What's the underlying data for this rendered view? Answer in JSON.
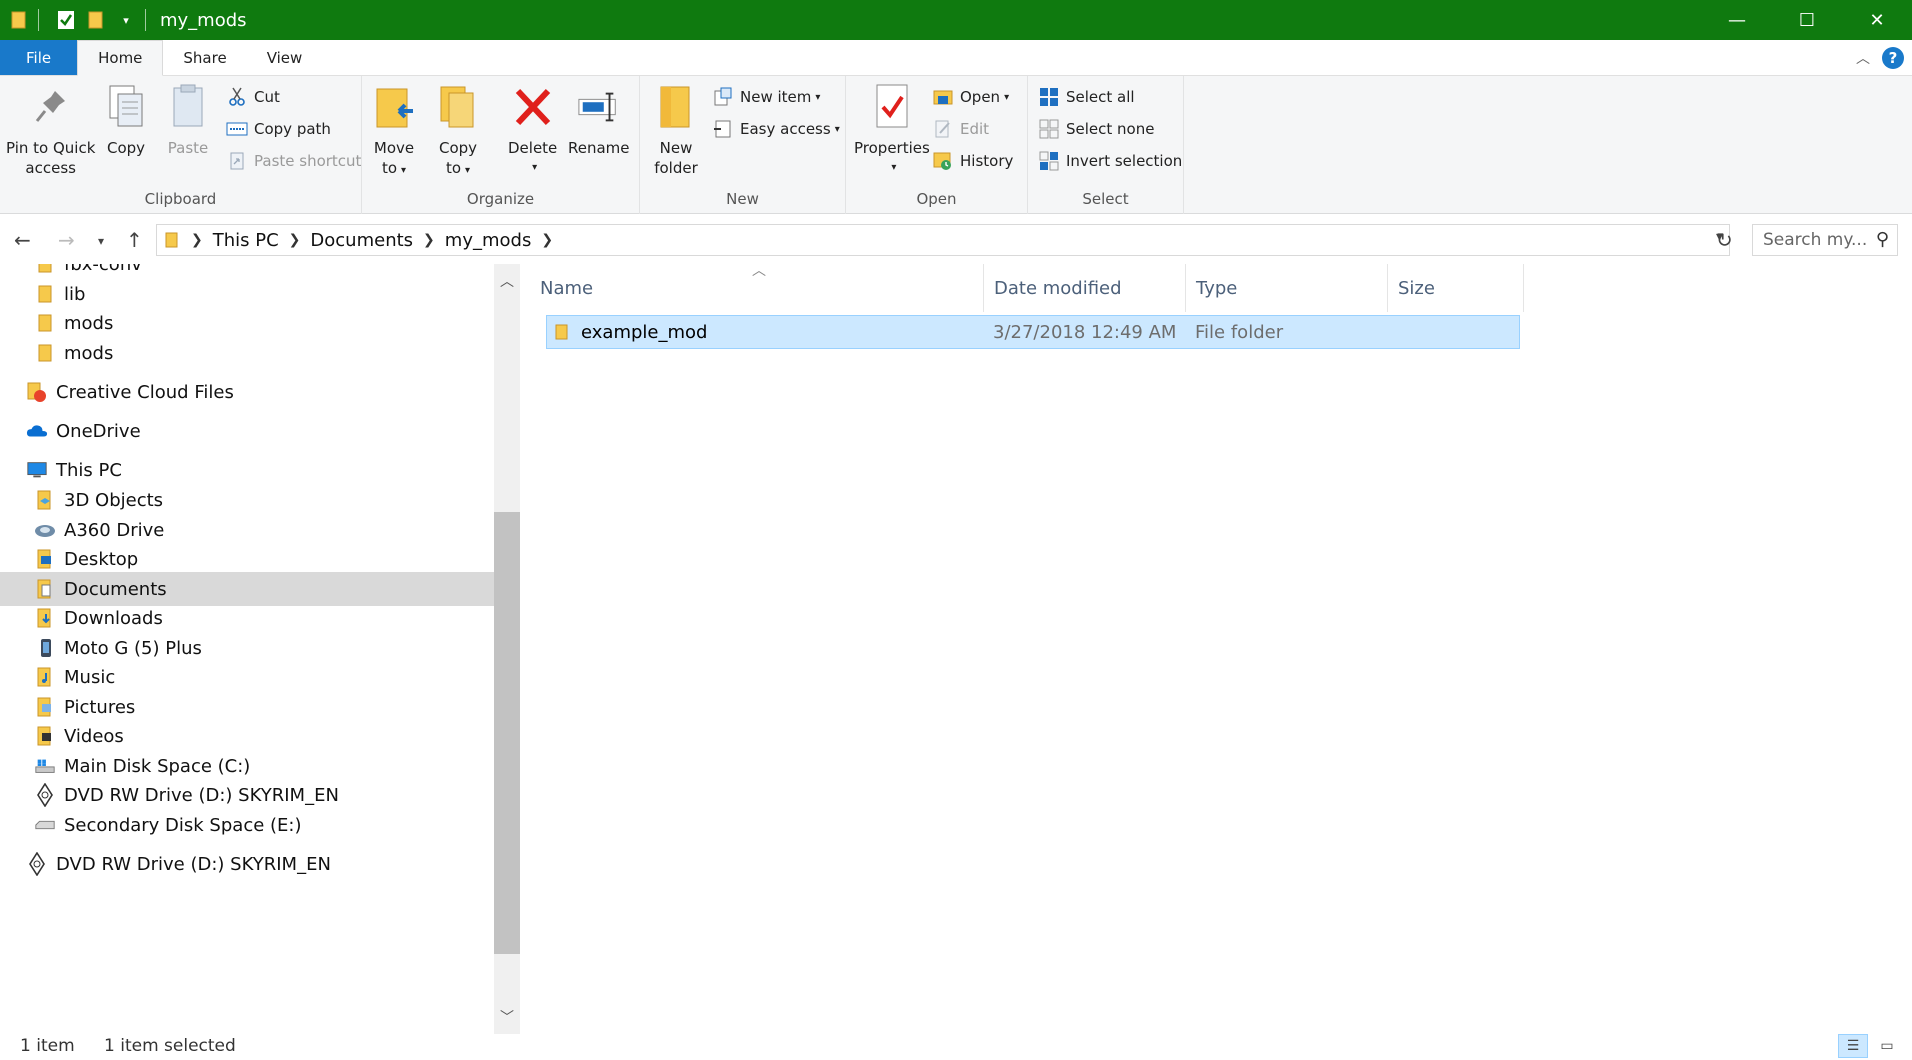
{
  "window": {
    "title": "my_mods",
    "minimize": "—",
    "maximize": "☐",
    "close": "✕"
  },
  "colors": {
    "titlebar": "#0f7a0f",
    "file_tab": "#1979ca",
    "selection": "#cce8ff",
    "selected_nav": "#d9d9d9",
    "folder": "#f6c94b"
  },
  "tabs": {
    "file": "File",
    "home": "Home",
    "share": "Share",
    "view": "View",
    "help": "?"
  },
  "ribbon": {
    "clipboard": {
      "label": "Clipboard",
      "pin_line1": "Pin to Quick",
      "pin_line2": "access",
      "copy": "Copy",
      "paste": "Paste",
      "cut": "Cut",
      "copy_path": "Copy path",
      "paste_shortcut": "Paste shortcut"
    },
    "organize": {
      "label": "Organize",
      "move_line1": "Move",
      "move_line2": "to",
      "copy_line1": "Copy",
      "copy_line2": "to",
      "delete": "Delete",
      "rename": "Rename"
    },
    "new": {
      "label": "New",
      "folder_line1": "New",
      "folder_line2": "folder",
      "new_item": "New item",
      "easy_access": "Easy access"
    },
    "open": {
      "label": "Open",
      "properties": "Properties",
      "open": "Open",
      "edit": "Edit",
      "history": "History"
    },
    "select": {
      "label": "Select",
      "select_all": "Select all",
      "select_none": "Select none",
      "invert": "Invert selection"
    }
  },
  "address": {
    "crumbs": [
      "This PC",
      "Documents",
      "my_mods"
    ],
    "search_placeholder": "Search my..."
  },
  "nav_tree": [
    {
      "label": "fbx-conv",
      "icon": "folder-icon",
      "level": 2
    },
    {
      "label": "lib",
      "icon": "folder-icon",
      "level": 2
    },
    {
      "label": "mods",
      "icon": "folder-icon",
      "level": 2
    },
    {
      "label": "mods",
      "icon": "folder-icon",
      "level": 2
    },
    {
      "label": "Creative Cloud Files",
      "icon": "creative-cloud-icon",
      "level": 1
    },
    {
      "label": "OneDrive",
      "icon": "onedrive-icon",
      "level": 1
    },
    {
      "label": "This PC",
      "icon": "computer-icon",
      "level": 1
    },
    {
      "label": "3D Objects",
      "icon": "folder-3d-icon",
      "level": 2
    },
    {
      "label": "A360 Drive",
      "icon": "a360-drive-icon",
      "level": 2
    },
    {
      "label": "Desktop",
      "icon": "desktop-folder-icon",
      "level": 2
    },
    {
      "label": "Documents",
      "icon": "documents-folder-icon",
      "level": 2,
      "selected": true
    },
    {
      "label": "Downloads",
      "icon": "downloads-folder-icon",
      "level": 2
    },
    {
      "label": "Moto G (5) Plus",
      "icon": "phone-icon",
      "level": 2
    },
    {
      "label": "Music",
      "icon": "music-folder-icon",
      "level": 2
    },
    {
      "label": "Pictures",
      "icon": "pictures-folder-icon",
      "level": 2
    },
    {
      "label": "Videos",
      "icon": "videos-folder-icon",
      "level": 2
    },
    {
      "label": "Main Disk Space (C:)",
      "icon": "windows-drive-icon",
      "level": 2
    },
    {
      "label": "DVD RW Drive (D:) SKYRIM_EN",
      "icon": "dvd-drive-icon",
      "level": 2
    },
    {
      "label": "Secondary Disk Space (E:)",
      "icon": "drive-icon",
      "level": 2
    },
    {
      "label": "DVD RW Drive (D:) SKYRIM_EN",
      "icon": "dvd-drive-icon",
      "level": 1
    }
  ],
  "columns": {
    "name": "Name",
    "date": "Date modified",
    "type": "Type",
    "size": "Size"
  },
  "files": [
    {
      "name": "example_mod",
      "date": "3/27/2018 12:49 AM",
      "type": "File folder",
      "size": ""
    }
  ],
  "status": {
    "count": "1 item",
    "selected": "1 item selected"
  }
}
